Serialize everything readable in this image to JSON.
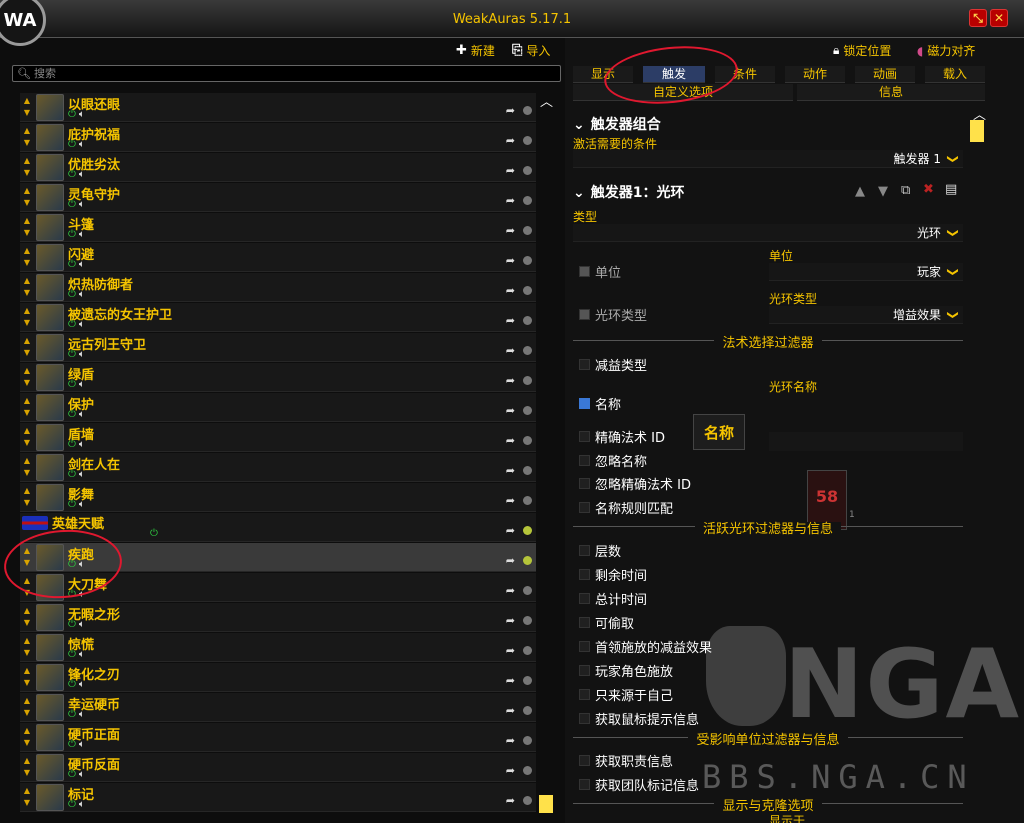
{
  "app": {
    "logo": "WA",
    "title": "WeakAuras 5.17.1",
    "minimize_icon": "resize-icon",
    "close_icon": "close-icon"
  },
  "toolbar": {
    "new_label": "新建",
    "import_label": "导入"
  },
  "search": {
    "placeholder": "搜索"
  },
  "auras": [
    {
      "name": "以眼还眼",
      "enabled": true
    },
    {
      "name": "庇护祝福",
      "enabled": true
    },
    {
      "name": "优胜劣汰",
      "enabled": true
    },
    {
      "name": "灵龟守护",
      "enabled": true
    },
    {
      "name": "斗篷",
      "enabled": true
    },
    {
      "name": "闪避",
      "enabled": true
    },
    {
      "name": "炽热防御者",
      "enabled": true
    },
    {
      "name": "被遗忘的女王护卫",
      "enabled": true
    },
    {
      "name": "远古列王守卫",
      "enabled": true
    },
    {
      "name": "绿盾",
      "enabled": true
    },
    {
      "name": "保护",
      "enabled": true
    },
    {
      "name": "盾墙",
      "enabled": true
    },
    {
      "name": "剑在人在",
      "enabled": true
    },
    {
      "name": "影舞",
      "enabled": true
    },
    {
      "name": "英雄天赋",
      "enabled": true,
      "group": true
    },
    {
      "name": "疾跑",
      "enabled": true,
      "selected": true
    },
    {
      "name": "大刀舞",
      "enabled": true
    },
    {
      "name": "无暇之形",
      "enabled": true
    },
    {
      "name": "惊慌",
      "enabled": true
    },
    {
      "name": "锋化之刃",
      "enabled": true
    },
    {
      "name": "幸运硬币",
      "enabled": true
    },
    {
      "name": "硬币正面",
      "enabled": true
    },
    {
      "name": "硬币反面",
      "enabled": true
    },
    {
      "name": "标记",
      "enabled": true
    }
  ],
  "right": {
    "lock_label": "锁定位置",
    "magnet_label": "磁力对齐",
    "tabs": [
      "显示",
      "触发",
      "条件",
      "动作",
      "动画",
      "载入"
    ],
    "tabs2": [
      "自定义选项",
      "信息"
    ],
    "active_tab": "触发"
  },
  "trigger": {
    "combo_header": "触发器组合",
    "activation_label": "激活需要的条件",
    "activation_value": "触发器 1",
    "trigger_header": "触发器1：光环",
    "type_label": "类型",
    "type_value": "光环",
    "unit_label": "单位",
    "unit_check": "单位",
    "unit_value": "玩家",
    "aura_type_label": "光环类型",
    "aura_type_check": "光环类型",
    "aura_type_value": "增益效果",
    "spell_filter_header": "法术选择过滤器",
    "debuff_type": "减益类型",
    "tooltip_name": "名称",
    "aura_name_label": "光环名称",
    "name_check": "名称",
    "exact_spell_id": "精确法术 ID",
    "ignore_name": "忽略名称",
    "ignore_exact_id": "忽略精确法术 ID",
    "name_pattern": "名称规则匹配",
    "preview_number": "58",
    "preview_count": "1",
    "active_filter_header": "活跃光环过滤器与信息",
    "options": [
      "层数",
      "剩余时间",
      "总计时间",
      "可偷取",
      "首领施放的减益效果",
      "玩家角色施放",
      "只来源于自己",
      "获取鼠标提示信息"
    ],
    "affected_header": "受影响单位过滤器与信息",
    "affected_options": [
      "获取职责信息",
      "获取团队标记信息"
    ],
    "display_clone_header": "显示与克隆选项",
    "display_label": "显示于"
  },
  "watermark": {
    "text": "NGA",
    "url": "BBS.NGA.CN"
  },
  "colors": {
    "accent": "#f5c400",
    "active_tab": "#2c3d66",
    "annotation_circle": "#e0182f",
    "checkbox_on": "#3a78d6"
  }
}
